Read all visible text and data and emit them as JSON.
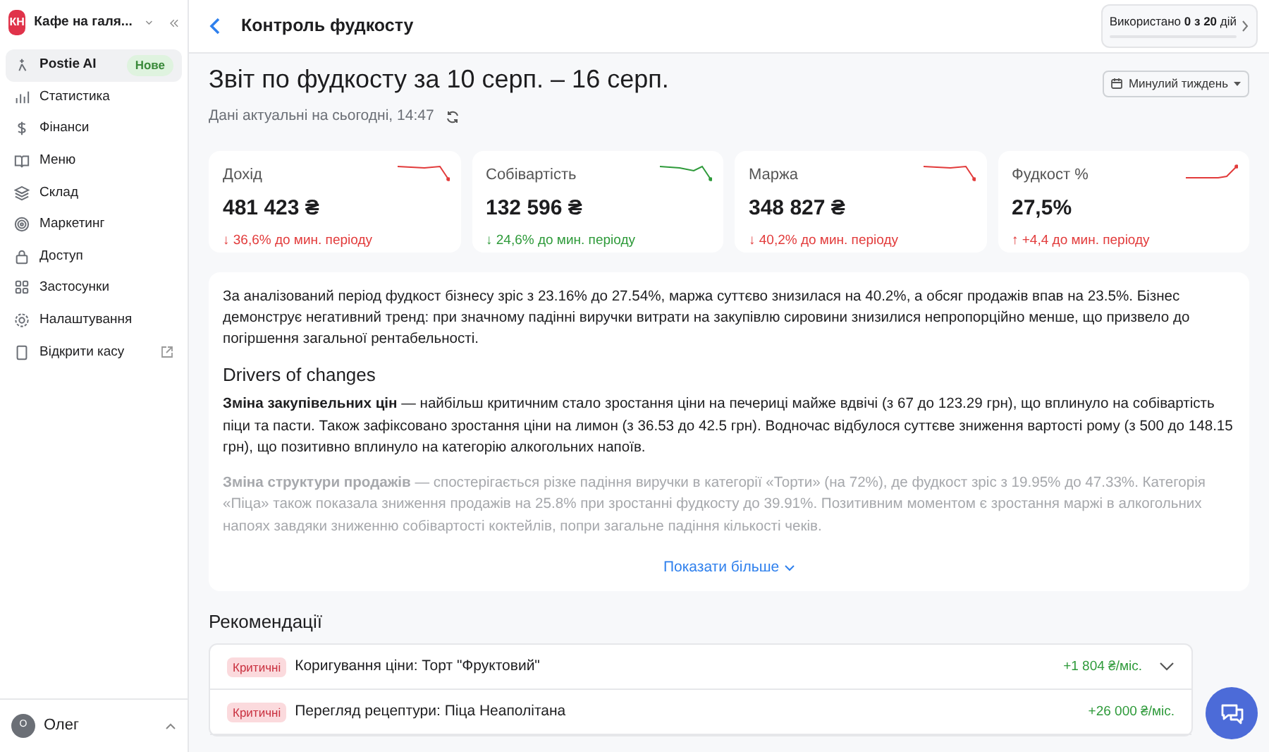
{
  "sidebar": {
    "org": {
      "initials": "КН",
      "name": "Кафе на галя..."
    },
    "items": [
      {
        "label": "Postie AI",
        "badge": "Нове",
        "selected": true,
        "external": false
      },
      {
        "label": "Статистика",
        "selected": false,
        "external": false
      },
      {
        "label": "Фінанси",
        "selected": false,
        "external": false
      },
      {
        "label": "Меню",
        "selected": false,
        "external": false
      },
      {
        "label": "Склад",
        "selected": false,
        "external": false
      },
      {
        "label": "Маркетинг",
        "selected": false,
        "external": false
      },
      {
        "label": "Доступ",
        "selected": false,
        "external": false
      },
      {
        "label": "Застосунки",
        "selected": false,
        "external": false
      },
      {
        "label": "Налаштування",
        "selected": false,
        "external": false
      },
      {
        "label": "Відкрити касу",
        "selected": false,
        "external": true
      }
    ],
    "user": {
      "initial": "О",
      "name": "Олег"
    }
  },
  "header": {
    "title": "Контроль фудкосту",
    "usage": {
      "text": "Використано **0 з 20** дій",
      "level": 0
    }
  },
  "report": {
    "title": "Звіт по фудкосту за 10 серп. – 16 серп.",
    "updated": "Дані актуальні на сьогодні, 14:47",
    "period": "Минулий тиждень"
  },
  "metrics": [
    {
      "label": "Дохід",
      "value": "481 423 ₴",
      "change": "↓ 36,6% до мин. періоду",
      "color": "#e23b3b"
    },
    {
      "label": "Собівартість",
      "value": "132 596 ₴",
      "change": "↓ 24,6% до мин. періоду",
      "color": "#2e9a3a"
    },
    {
      "label": "Маржа",
      "value": "348 827 ₴",
      "change": "↓ 40,2% до мин. періоду",
      "color": "#e23b3b"
    },
    {
      "label": "Фудкост %",
      "value": "27,5%",
      "change": "↑ +4,4 до мин. періоду",
      "color": "#e23b3b"
    }
  ],
  "summary": {
    "blocks": [
      {
        "kind": "text",
        "text": "За аналізований період фудкост бізнесу зріс з 23.16% до 27.54%, маржа суттєво знизилася на 40.2%, а обсяг продажів впав на 23.5%. Бізнес демонструє негативний тренд: при значному падінні виручки витрати на закупівлю сировини знизилися непропорційно менше, що призвело до погіршення загальної рентабельності.",
        "faded": false
      },
      {
        "kind": "heading",
        "text": "Drivers of changes",
        "faded": false
      },
      {
        "kind": "text",
        "text": "**Зміна закупівельних цін** — найбільш критичним стало зростання ціни на печериці майже вдвічі (з 67 до 123.29 грн), що вплинуло на собівартість піци та пасти. Також зафіксовано зростання ціни на лимон (з 36.53 до 42.5 грн). Водночас відбулося суттєве зниження вартості рому (з 500 до 148.15 грн), що позитивно вплинуло на категорію алкогольних напоїв.",
        "faded": false
      },
      {
        "kind": "text",
        "text": "**Зміна структури продажів** — спостерігається різке падіння виручки в категорії «Торти» (на 72%), де фудкост зріс з 19.95% до 47.33%. Категорія «Піца» також показала зниження продажів на 25.8% при зростанні фудкосту до 39.91%. Позитивним моментом є зростання маржі в алкогольних напоях завдяки зниженню собівартості коктейлів, попри загальне падіння кількості чеків.",
        "faded": true
      }
    ],
    "more": "Показати більше"
  },
  "recommendations": {
    "title": "Рекомендації",
    "items": [
      {
        "tag": "Критичні",
        "title": "Коригування ціни: Торт \"Фруктовий\"",
        "value": "+1 804 ₴/міс."
      },
      {
        "tag": "Критичні",
        "title": "Перегляд рецептури: Піца Неаполітана",
        "value": "+26 000 ₴/міс."
      }
    ]
  }
}
